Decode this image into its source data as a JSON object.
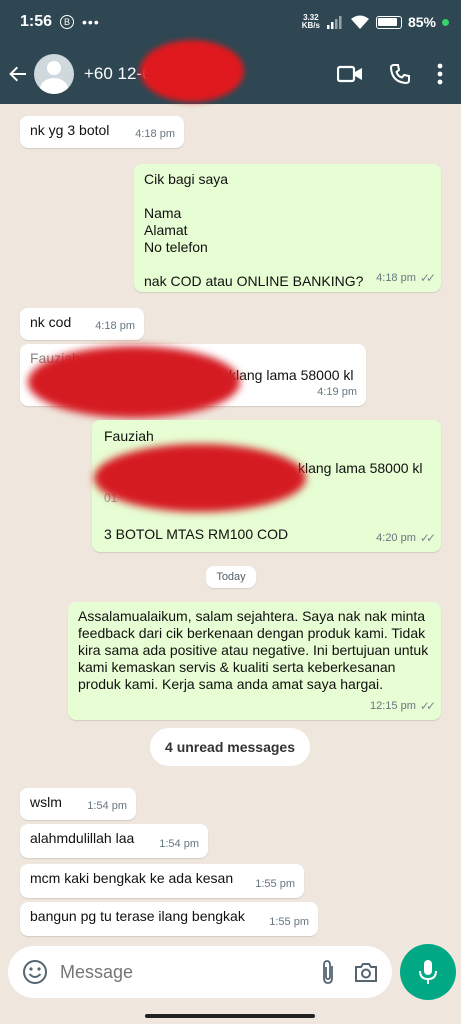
{
  "status": {
    "time": "1:56",
    "net_top": "3.32",
    "net_bottom": "KB/s",
    "battery": "85%"
  },
  "header": {
    "contact": "+60 12-6"
  },
  "messages": [
    {
      "dir": "in",
      "text": "nk yg 3 botol",
      "time": "4:18 pm"
    },
    {
      "dir": "out",
      "text": "Cik bagi saya\n\nNama\nAlamat\nNo telefon\n\nnak COD atau ONLINE BANKING?",
      "time": "4:18 pm"
    },
    {
      "dir": "in",
      "text": "nk cod",
      "time": "4:18 pm"
    },
    {
      "dir": "in",
      "text_partial": "Fauziah",
      "text_tail": "klang lama 58000 kl",
      "time": "4:19 pm"
    },
    {
      "dir": "out",
      "text_name": "Fauziah",
      "text_tail": "klang lama 58000 kl",
      "text_partial": "01",
      "text_last": "3 BOTOL MTAS RM100 COD",
      "time": "4:20 pm"
    },
    {
      "dir": "out",
      "text": "Assalamualaikum, salam sejahtera. Saya nak nak minta feedback dari cik berkenaan dengan produk kami. Tidak kira sama ada positive atau negative. Ini bertujuan untuk kami kemaskan servis & kualiti serta keberkesanan produk kami. Kerja sama anda amat saya hargai.",
      "time": "12:15 pm"
    },
    {
      "dir": "in",
      "text": "wslm",
      "time": "1:54 pm"
    },
    {
      "dir": "in",
      "text": "alahmdulillah laa",
      "time": "1:54 pm"
    },
    {
      "dir": "in",
      "text": "mcm kaki bengkak ke ada kesan",
      "time": "1:55 pm"
    },
    {
      "dir": "in",
      "text": "bangun pg tu terase ilang bengkak",
      "time": "1:55 pm"
    }
  ],
  "date_divider": "Today",
  "unread_label": "4 unread messages",
  "composer": {
    "placeholder": "Message"
  },
  "colors": {
    "header": "#2e4752",
    "outgoing": "#e7fdd3",
    "accent": "#00a884"
  }
}
